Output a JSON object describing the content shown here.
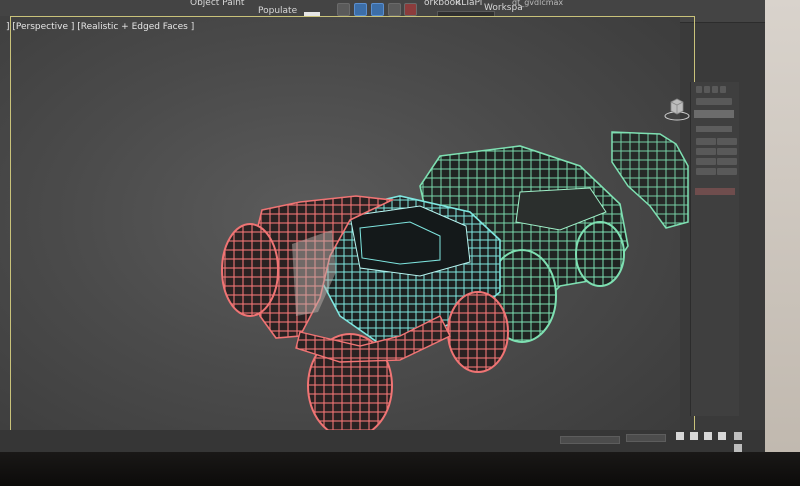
{
  "toolbar": {
    "object_paint": "Object Paint",
    "populate": "Populate",
    "menu_partial_1": "orkbook",
    "menu_partial_2": "RLTaPi",
    "menu_partial_3": "Workspa",
    "file_title": "dt_gvdlcmax"
  },
  "viewport": {
    "label": "] [Perspective ] [Realistic + Edged Faces ]"
  },
  "icons": {
    "viewcube": "viewcube-icon",
    "select": "select-icon",
    "move": "move-icon",
    "snap": "snap-icon",
    "render": "teapot-icon"
  },
  "colors": {
    "wire_red": "#f07474",
    "wire_cyan": "#7fe6e0",
    "wire_green": "#7ee0b2",
    "panel": "#3f3f3f",
    "viewport_border": "#c9c27a"
  }
}
